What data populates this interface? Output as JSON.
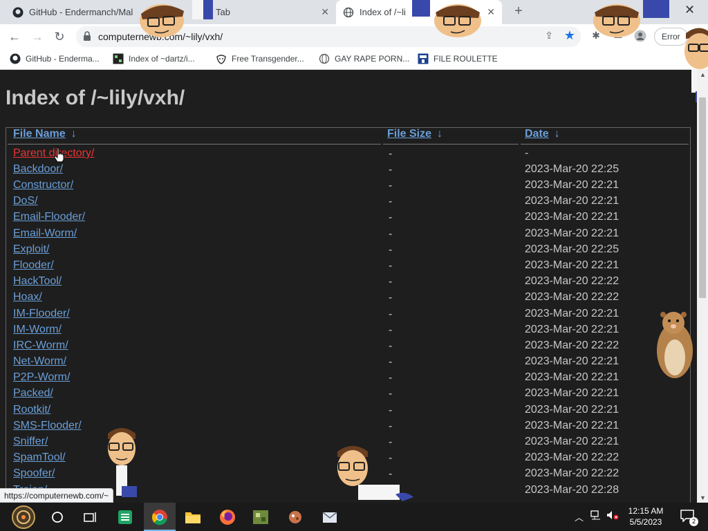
{
  "browser": {
    "tabs": [
      {
        "title": "GitHub - Endermanch/Mal",
        "icon": "github-icon",
        "active": false
      },
      {
        "title": "Tab",
        "icon": "page-icon",
        "active": false
      },
      {
        "title": "Index of /~li",
        "icon": "globe-icon",
        "active": true
      }
    ],
    "new_tab": "+",
    "close_window": "✕",
    "url": "computernewb.com/~lily/vxh/",
    "error_button": "Error",
    "accent_color": "#1a73e8"
  },
  "bookmarks": [
    {
      "label": "GitHub - Enderma...",
      "icon": "github-icon"
    },
    {
      "label": "Index of ~dartz/i...",
      "icon": "index-icon"
    },
    {
      "label": "Free Transgender...",
      "icon": "mask-icon"
    },
    {
      "label": "GAY RAPE PORN...",
      "icon": "globe-icon"
    },
    {
      "label": "FILE ROULETTE",
      "icon": "mft-icon"
    }
  ],
  "page": {
    "title": "Index of /~lily/vxh/",
    "columns": {
      "name": "File Name",
      "size": "File Size",
      "date": "Date",
      "sort_arrow": "↓"
    },
    "rows": [
      {
        "name": "Parent directory/",
        "size": "-",
        "date": "-"
      },
      {
        "name": "Backdoor/",
        "size": "-",
        "date": "2023-Mar-20 22:25"
      },
      {
        "name": "Constructor/",
        "size": "-",
        "date": "2023-Mar-20 22:21"
      },
      {
        "name": "DoS/",
        "size": "-",
        "date": "2023-Mar-20 22:21"
      },
      {
        "name": "Email-Flooder/",
        "size": "-",
        "date": "2023-Mar-20 22:21"
      },
      {
        "name": "Email-Worm/",
        "size": "-",
        "date": "2023-Mar-20 22:21"
      },
      {
        "name": "Exploit/",
        "size": "-",
        "date": "2023-Mar-20 22:25"
      },
      {
        "name": "Flooder/",
        "size": "-",
        "date": "2023-Mar-20 22:21"
      },
      {
        "name": "HackTool/",
        "size": "-",
        "date": "2023-Mar-20 22:22"
      },
      {
        "name": "Hoax/",
        "size": "-",
        "date": "2023-Mar-20 22:22"
      },
      {
        "name": "IM-Flooder/",
        "size": "-",
        "date": "2023-Mar-20 22:21"
      },
      {
        "name": "IM-Worm/",
        "size": "-",
        "date": "2023-Mar-20 22:21"
      },
      {
        "name": "IRC-Worm/",
        "size": "-",
        "date": "2023-Mar-20 22:22"
      },
      {
        "name": "Net-Worm/",
        "size": "-",
        "date": "2023-Mar-20 22:21"
      },
      {
        "name": "P2P-Worm/",
        "size": "-",
        "date": "2023-Mar-20 22:21"
      },
      {
        "name": "Packed/",
        "size": "-",
        "date": "2023-Mar-20 22:21"
      },
      {
        "name": "Rootkit/",
        "size": "-",
        "date": "2023-Mar-20 22:21"
      },
      {
        "name": "SMS-Flooder/",
        "size": "-",
        "date": "2023-Mar-20 22:21"
      },
      {
        "name": "Sniffer/",
        "size": "-",
        "date": "2023-Mar-20 22:21"
      },
      {
        "name": "SpamTool/",
        "size": "-",
        "date": "2023-Mar-20 22:22"
      },
      {
        "name": "Spoofer/",
        "size": "-",
        "date": "2023-Mar-20 22:22"
      },
      {
        "name": "Trojan/",
        "size": "-",
        "date": "2023-Mar-20 22:28"
      }
    ],
    "link_color": "#6a9fd8",
    "hover_link_color": "#ee3333"
  },
  "status_bar": {
    "text": "https://computernewb.com/~"
  },
  "taskbar": {
    "time": "12:15 AM",
    "date": "5/5/2023",
    "notification_count": "2",
    "apps": [
      "start-icon",
      "search-circle-icon",
      "task-view-icon",
      "sheets-icon",
      "chrome-icon",
      "file-explorer-icon",
      "firefox-icon",
      "game-icon",
      "app-icon",
      "mail-icon"
    ]
  }
}
